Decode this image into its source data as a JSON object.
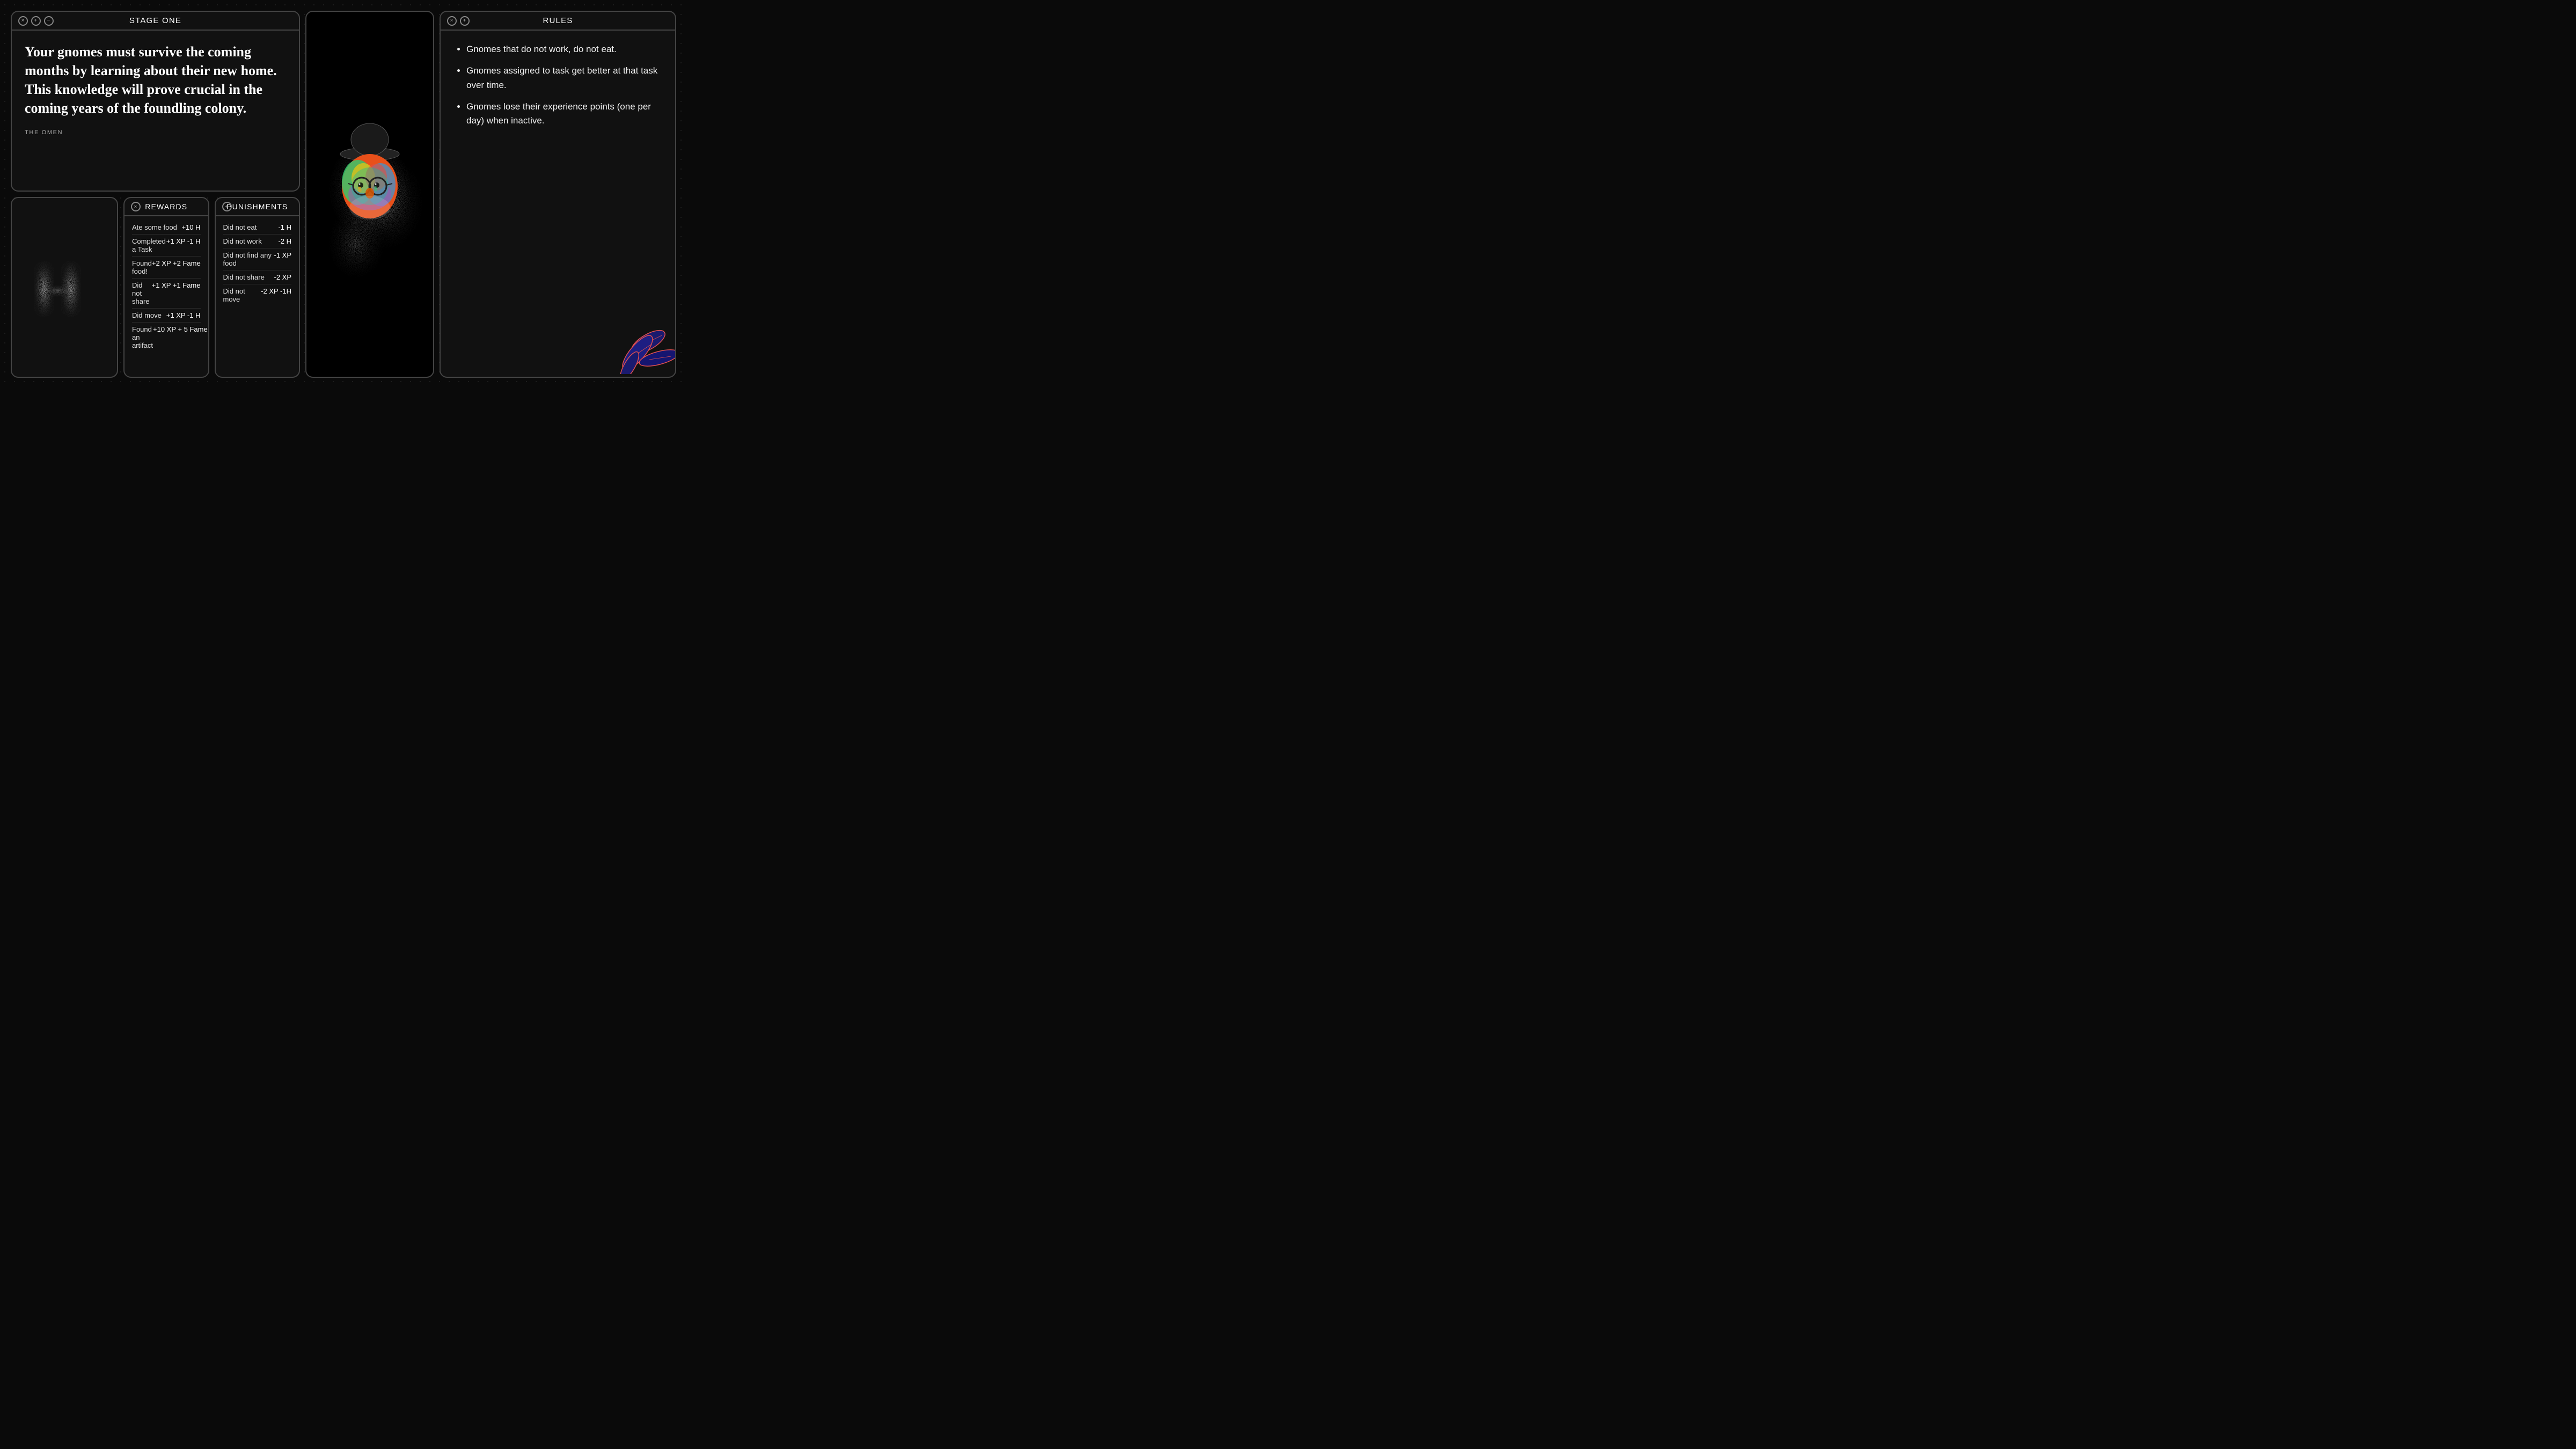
{
  "stage": {
    "window_title": "STAGE ONE",
    "body_text": "Your gnomes must survive the coming months by learning about their new home. This knowledge will prove crucial in the coming years of the foundling colony.",
    "omen_label": "THE OMEN",
    "controls": [
      "×",
      "+",
      "−"
    ]
  },
  "rules": {
    "window_title": "RULES",
    "controls": [
      "×",
      "+"
    ],
    "items": [
      "Gnomes that do not work, do not eat.",
      "Gnomes assigned to task get better at that task over time.",
      "Gnomes lose their experience points (one per day) when inactive."
    ]
  },
  "rewards": {
    "title": "REWARDS",
    "control": "×",
    "rows": [
      {
        "label": "Ate some food",
        "value": "+10 H"
      },
      {
        "label": "Completed a Task",
        "value": "+1 XP -1 H"
      },
      {
        "label": "Found food!",
        "value": "+2 XP +2 Fame"
      },
      {
        "label": "Did not share",
        "value": "+1 XP +1 Fame"
      },
      {
        "label": "Did move",
        "value": "+1 XP -1 H"
      },
      {
        "label": "Found an artifact",
        "value": "+10 XP + 5 Fame"
      }
    ]
  },
  "punishments": {
    "title": "PUNISHMENTS",
    "control": "+",
    "rows": [
      {
        "label": "Did not eat",
        "value": "-1 H"
      },
      {
        "label": "Did not work",
        "value": "-2 H"
      },
      {
        "label": "Did not find any food",
        "value": "-1 XP"
      },
      {
        "label": "Did not share",
        "value": "-2 XP"
      },
      {
        "label": "Did not move",
        "value": "-2 XP -1H"
      }
    ]
  },
  "colors": {
    "bg": "#0a0a0a",
    "card_bg": "#111111",
    "border": "#444444",
    "text": "#ffffff",
    "muted": "#aaaaaa"
  }
}
